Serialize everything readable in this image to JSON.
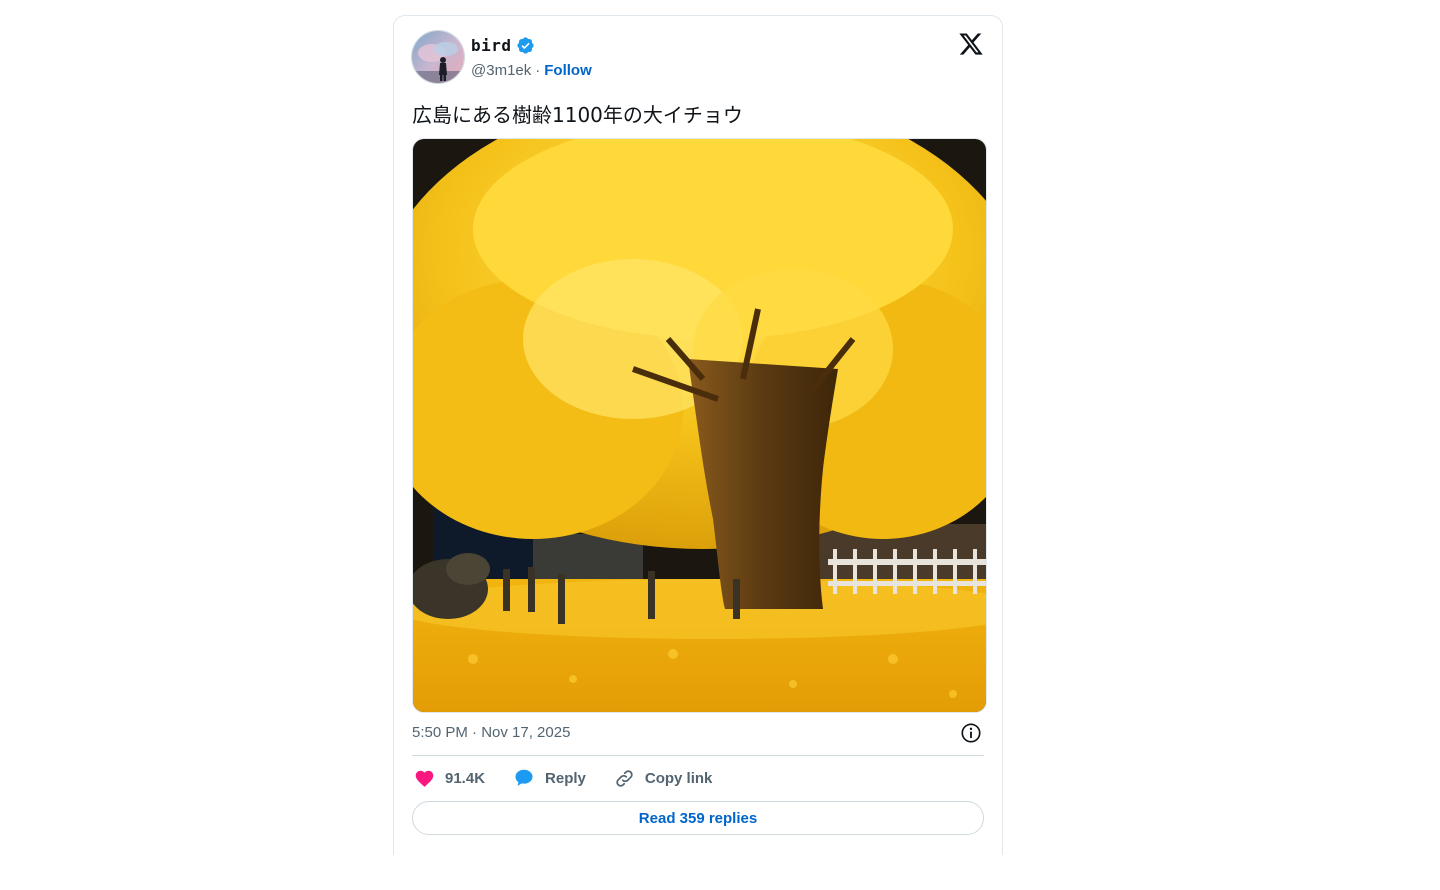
{
  "tweet": {
    "author": {
      "display_name": "bird",
      "handle": "@3m1ek",
      "verified_icon": "verified-badge-icon",
      "follow_label": "Follow",
      "separator": "·"
    },
    "text": "広島にある樹齢1100年の大イチョウ",
    "media": {
      "subject": "ginkgo tree at night with yellow leaves"
    },
    "timestamp": "5:50 PM · Nov 17, 2025",
    "actions": {
      "like_count": "91.4K",
      "reply_label": "Reply",
      "copy_link_label": "Copy link"
    },
    "read_replies_label": "Read 359 replies"
  },
  "colors": {
    "accent": "#0066cc",
    "like": "#f91880",
    "reply": "#1d9bf0",
    "verified": "#1d9bf0",
    "text": "#0f1419",
    "secondary": "#536471"
  }
}
